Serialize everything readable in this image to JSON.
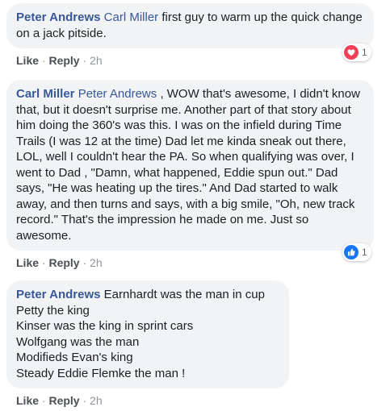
{
  "common": {
    "like_label": "Like",
    "reply_label": "Reply",
    "separator": "·"
  },
  "comments": [
    {
      "author": "Peter Andrews",
      "mention": "Carl Miller",
      "text": "first guy to warm up the quick change on a jack pitside.",
      "time": "2h",
      "reaction": {
        "type": "love",
        "count": "1",
        "color": "#f33e58"
      }
    },
    {
      "author": "Carl Miller",
      "mention": "Peter Andrews",
      "text": ", WOW that's awesome, I didn't know that, but it doesn't surprise me. Another part of that story about him doing the 360's was this. I was on the infield during Time Trails (I was 12 at the time) Dad let me kinda sneak out there, LOL, well I couldn't hear the PA. So when qualifying was over, I went to Dad , \"Damn, what happened, Eddie spun out.\" Dad says, \"He was heating up the tires.\" And Dad started to walk away, and then turns and says, with a big smile, \"Oh, new track record.\" That's the impression he made on me. Just so awesome.",
      "time": "2h",
      "reaction": {
        "type": "like",
        "count": "1",
        "color": "#1877f2"
      }
    },
    {
      "author": "Peter Andrews",
      "text": "Earnhardt was the man in cup\nPetty the king\nKinser was the king in sprint cars\nWolfgang was the man\nModifieds Evan's king\nSteady Eddie Flemke the man !",
      "time": "2h"
    }
  ]
}
